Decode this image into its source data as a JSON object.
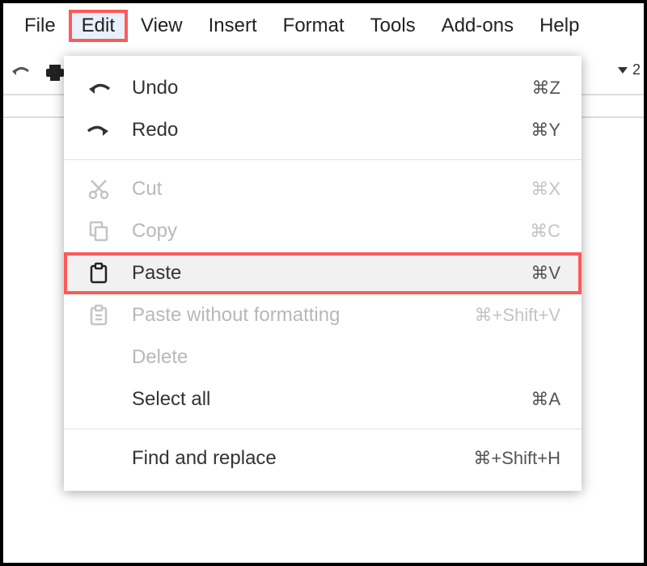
{
  "menubar": {
    "items": [
      {
        "label": "File"
      },
      {
        "label": "Edit"
      },
      {
        "label": "View"
      },
      {
        "label": "Insert"
      },
      {
        "label": "Format"
      },
      {
        "label": "Tools"
      },
      {
        "label": "Add-ons"
      },
      {
        "label": "Help"
      }
    ],
    "active_index": 1
  },
  "toolbar": {
    "right_text": "2"
  },
  "edit_menu": {
    "undo": {
      "label": "Undo",
      "shortcut": "⌘Z"
    },
    "redo": {
      "label": "Redo",
      "shortcut": "⌘Y"
    },
    "cut": {
      "label": "Cut",
      "shortcut": "⌘X"
    },
    "copy": {
      "label": "Copy",
      "shortcut": "⌘C"
    },
    "paste": {
      "label": "Paste",
      "shortcut": "⌘V"
    },
    "paste_nofmt": {
      "label": "Paste without formatting",
      "shortcut": "⌘+Shift+V"
    },
    "delete": {
      "label": "Delete",
      "shortcut": ""
    },
    "select_all": {
      "label": "Select all",
      "shortcut": "⌘A"
    },
    "find_replace": {
      "label": "Find and replace",
      "shortcut": "⌘+Shift+H"
    }
  }
}
